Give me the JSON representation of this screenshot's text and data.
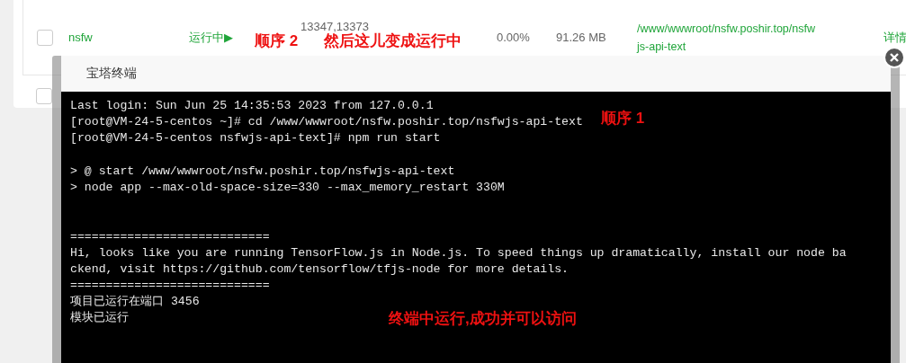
{
  "table": {
    "rows": [
      {
        "checked": false,
        "name": "nsfw",
        "status": "运行中▶",
        "pid": "13347,13373",
        "cpu": "0.00%",
        "memory": "91.26 MB",
        "path": "/www/wwwroot/nsfw.poshir.top/nsfwjs-api-text",
        "action": "详情"
      },
      {
        "checked": false
      }
    ]
  },
  "terminal_dialog": {
    "title": "宝塔终端",
    "blocks": [
      {
        "lines": [
          "Last login: Sun Jun 25 14:35:53 2023 from 127.0.0.1",
          "[root@VM-24-5-centos ~]# cd /www/wwwroot/nsfw.poshir.top/nsfwjs-api-text",
          "[root@VM-24-5-centos nsfwjs-api-text]# npm run start"
        ]
      },
      {
        "lines": [
          "> @ start /www/wwwroot/nsfw.poshir.top/nsfwjs-api-text",
          "> node app --max-old-space-size=330 --max_memory_restart 330M"
        ]
      },
      {
        "lines": [
          "============================",
          "Hi, looks like you are running TensorFlow.js in Node.js. To speed things up dramatically, install our node ba",
          "ckend, visit https://github.com/tensorflow/tfjs-node for more details.",
          "============================",
          "项目已运行在端口 3456",
          "模块已运行"
        ]
      }
    ]
  },
  "annotations": [
    {
      "text": "顺序 2"
    },
    {
      "text": "然后这儿变成运行中"
    },
    {
      "text": "顺序 1"
    },
    {
      "text": "终端中运行,成功并可以访问"
    }
  ]
}
